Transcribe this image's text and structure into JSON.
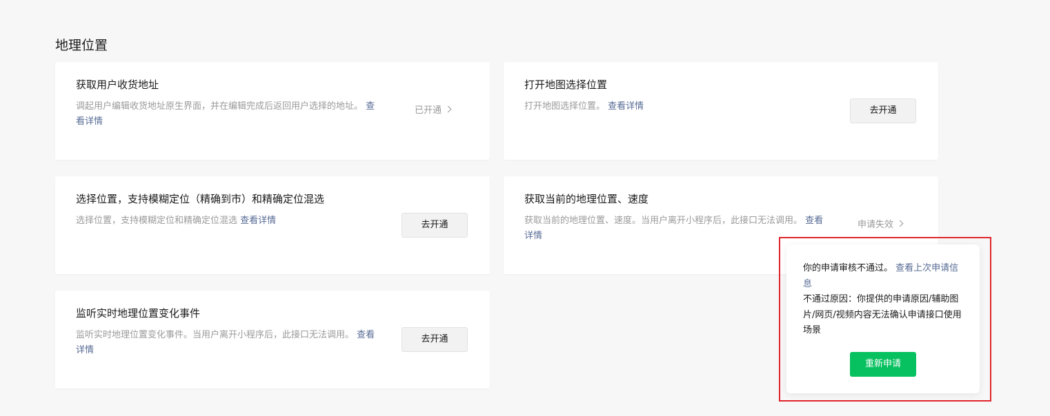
{
  "section": {
    "title": "地理位置"
  },
  "cards": {
    "address": {
      "title": "获取用户收货地址",
      "desc_line1": "调起用户编辑收货地址原生界面，并在编辑完成后返回用户选择的地",
      "desc_line2": "址。",
      "link": "查看详情",
      "status": "已开通"
    },
    "map_choose": {
      "title": "打开地图选择位置",
      "desc": "打开地图选择位置。",
      "link": "查看详情",
      "button": "去开通"
    },
    "fuzzy": {
      "title": "选择位置，支持模糊定位（精确到市）和精确定位混选",
      "desc": "选择位置，支持模糊定位和精确定位混选",
      "link": "查看详情",
      "button": "去开通"
    },
    "location": {
      "title": "获取当前的地理位置、速度",
      "desc": "获取当前的地理位置、速度。当用户离开小程序后，此接口无法调用。",
      "link": "查看详情",
      "status": "申请失效"
    },
    "listen": {
      "title": "监听实时地理位置变化事件",
      "desc": "监听实时地理位置变化事件。当用户离开小程序后，此接口无法调用。",
      "link": "查看详情",
      "button": "去开通"
    }
  },
  "popover": {
    "message": "你的申请审核不通过。",
    "link": "查看上次申请信息",
    "reason": "不通过原因：你提供的申请原因/辅助图片/网页/视频内容无法确认申请接口使用场景",
    "button": "重新申请"
  },
  "colors": {
    "link": "#576b95",
    "primary": "#07c160",
    "highlight": "#e0232a",
    "muted": "#9a9a9a"
  },
  "icons": {
    "status_chevron": "chevron-right-icon"
  }
}
